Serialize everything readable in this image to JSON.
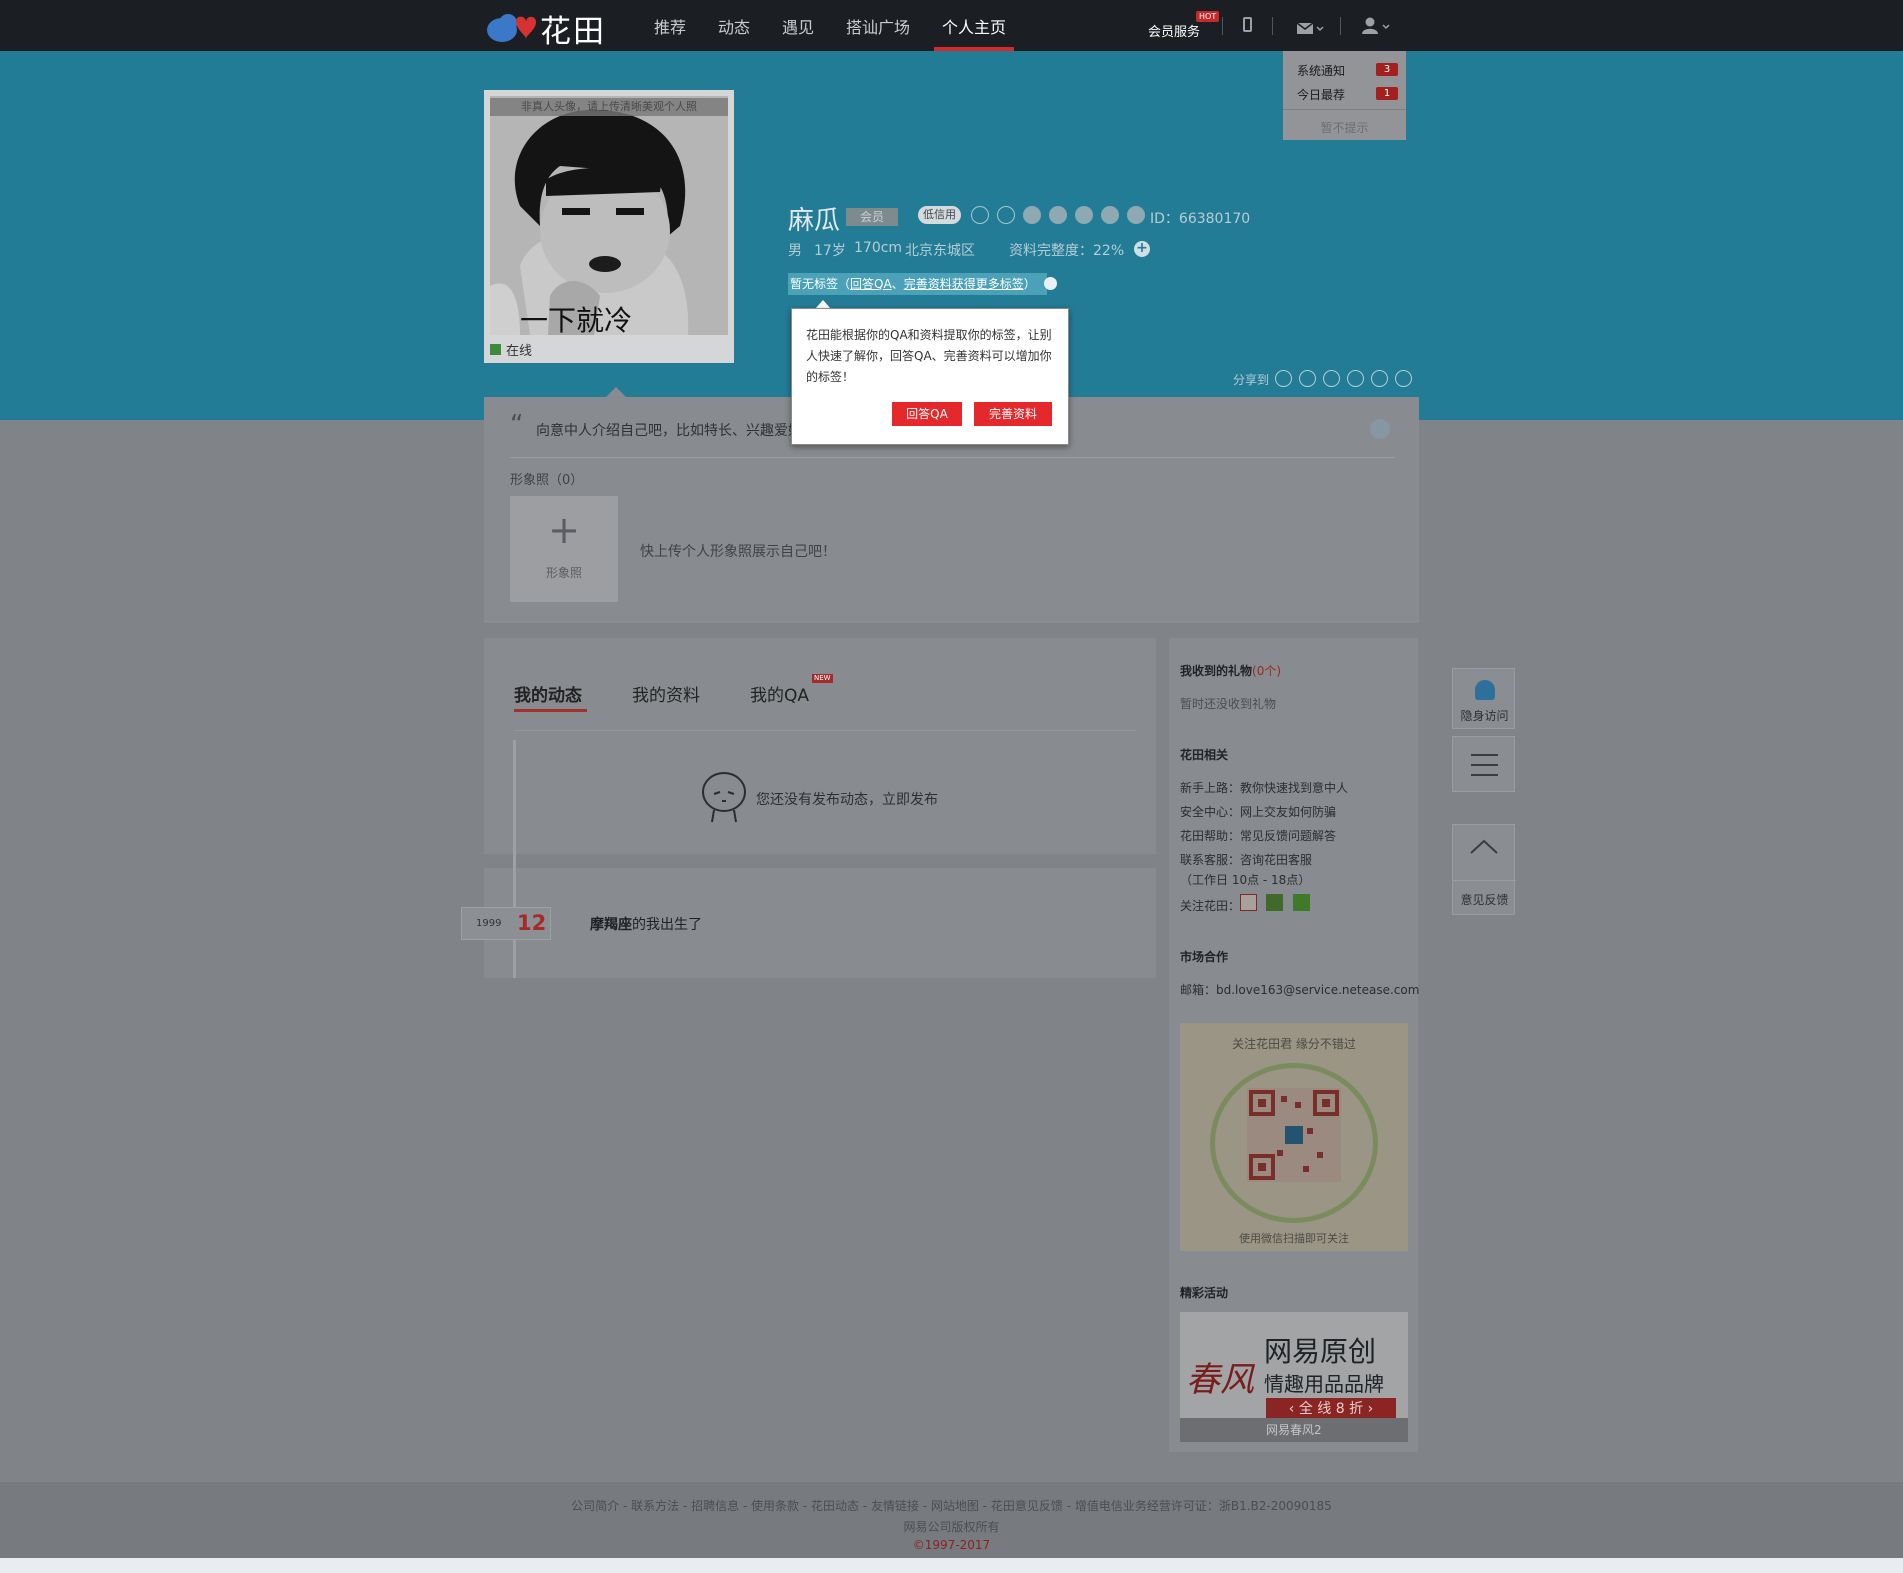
{
  "header": {
    "logo_text": "花田",
    "nav": [
      "推荐",
      "动态",
      "遇见",
      "搭讪广场",
      "个人主页"
    ],
    "vip_service": "会员服务",
    "hot_badge": "HOT"
  },
  "notifications": {
    "items": [
      {
        "label": "系统通知",
        "count": "3"
      },
      {
        "label": "今日最荐",
        "count": "1"
      }
    ],
    "dismiss": "暂不提示"
  },
  "avatar": {
    "note": "非真人头像，请上传清晰美观个人照",
    "status": "在线"
  },
  "profile": {
    "name": "麻瓜",
    "member_badge": "会员",
    "credit": "低信用",
    "id": "ID：66380170",
    "gender": "男",
    "age": "17岁",
    "height": "170cm",
    "location": "北京东城区",
    "completeness": "资料完整度：22%",
    "tags_prefix": "暂无标签（",
    "tags_link1": "回答QA",
    "tags_sep": "、",
    "tags_link2": "完善资料获得更多标签",
    "tags_suffix": "）"
  },
  "popup": {
    "text": "花田能根据你的QA和资料提取你的标签，让别人快速了解你，回答QA、完善资料可以增加你的标签！",
    "btn_qa": "回答QA",
    "btn_profile": "完善资料"
  },
  "share": {
    "label": "分享到"
  },
  "intro": {
    "text": "向意中人介绍自己吧，比如特长、兴趣爱好…",
    "photo_label": "形象照（0）",
    "photo_button": "形象照",
    "photo_hint": "快上传个人形象照展示自己吧！"
  },
  "tabs": {
    "items": [
      "我的动态",
      "我的资料",
      "我的QA"
    ],
    "new_badge": "NEW"
  },
  "feed": {
    "empty_prefix": "您还没有发布动态，",
    "empty_link": "立即发布",
    "event_year": "1999",
    "event_month": "12",
    "event_bold": "摩羯座",
    "event_rest": "的我出生了"
  },
  "sidebar": {
    "gifts_title": "我收到的礼物",
    "gifts_count": "(0个)",
    "gifts_empty": "暂时还没收到礼物",
    "about_title": "花田相关",
    "about": [
      {
        "k": "新手上路：",
        "v": "教你快速找到意中人"
      },
      {
        "k": "安全中心：",
        "v": "网上交友如何防骗"
      },
      {
        "k": "花田帮助：",
        "v": "常见反馈问题解答"
      },
      {
        "k": "联系客服：",
        "v": "咨询花田客服"
      }
    ],
    "hours": "（工作日 10点 - 18点）",
    "follow": "关注花田：",
    "market_title": "市场合作",
    "email": "邮箱：bd.love163@service.netease.com",
    "qr_top": "关注花田君 缘分不错过",
    "qr_bottom": "使用微信扫描即可关注",
    "events_title": "精彩活动",
    "ad_brand": "春风",
    "ad_title": "网易原创",
    "ad_sub": "情趣用品品牌",
    "ad_promo": "全 线 8 折",
    "ad_caption": "网易春风2"
  },
  "floating": {
    "incognito": "隐身访问",
    "feedback": "意见反馈"
  },
  "footer": {
    "links": "公司简介 - 联系方法 - 招聘信息 - 使用条款 - 花田动态 - 友情链接 - 网站地图 - 花田意见反馈 - 增值电信业务经营许可证：浙B1.B2-20090185",
    "copyright": "网易公司版权所有",
    "years": "©1997-2017"
  },
  "colors": {
    "banner": "#237c96",
    "accent_red": "#e5282b",
    "topbar": "#1b1e22"
  }
}
